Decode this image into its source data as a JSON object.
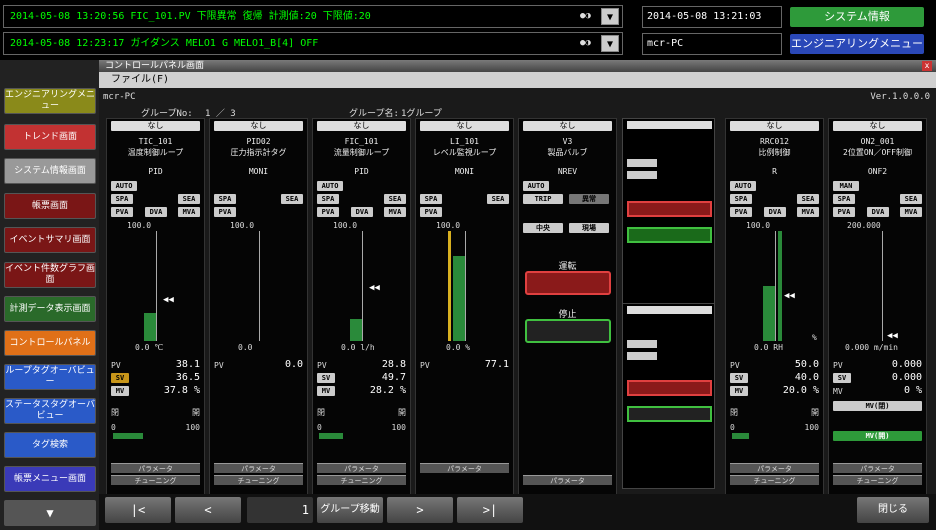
{
  "alarms": [
    {
      "text": "2014-05-08 13:20:56 FIC_101.PV 下限異常 復帰 計測値:20 下限値:20"
    },
    {
      "text": "2014-05-08 12:23:17 ガイダンス MELO1 G MELO1_B[4] OFF"
    }
  ],
  "datetime": "2014-05-08 13:21:03",
  "host": "mcr-PC",
  "sysinfo_label": "システム情報",
  "engmenu_label": "エンジニアリングメニュー",
  "sidebar": [
    "エンジニアリングメニュー",
    "トレンド画面",
    "システム情報画面",
    "帳票画面",
    "イベントサマリ画面",
    "イベント件数グラフ画面",
    "計測データ表示画面",
    "コントロールパネル",
    "ループタグオーバビュー",
    "ステータスタグオーバビュー",
    "タグ検索",
    "帳票メニュー画面"
  ],
  "window": {
    "title": "コントロールパネル画面",
    "menu": "ファイル(F)",
    "host": "mcr-PC",
    "version": "Ver.1.0.0.0",
    "group_no_label": "グループNo:",
    "group_no": "1 ／ 3",
    "group_name_label": "グループ名:",
    "group_name": "1グループ"
  },
  "colors": {
    "green_btn": "#2e9a3a",
    "blue_btn": "#2a48b8",
    "bar": "#2a8a3a"
  },
  "columns": [
    {
      "nashi": "なし",
      "tag": "TIC_101",
      "name": "温度制御ループ",
      "type": "PID",
      "auto": "AUTO",
      "spa": "SPA",
      "sea": "SEA",
      "pva": "PVA",
      "dva": "DVA",
      "mva": "MVA",
      "top": "100.0",
      "bottom": "0.0 ℃",
      "pv_label": "PV",
      "pv": "38.1",
      "sv_label": "SV",
      "sv": "36.5",
      "mv_label": "MV",
      "mv": "37.8 %",
      "close": "閉",
      "open": "開",
      "mv_low": "0",
      "mv_high": "100",
      "param": "パラメータ",
      "tuning": "チューニング",
      "bar_pct": 25,
      "mv_pct": 37.8
    },
    {
      "nashi": "なし",
      "tag": "PID02",
      "name": "圧力指示計タグ",
      "type": "MONI",
      "spa": "SPA",
      "sea": "SEA",
      "pva": "PVA",
      "top": "100.0",
      "bottom": "0.0",
      "pv_label": "PV",
      "pv": "0.0",
      "param": "パラメータ",
      "tuning": "チューニング",
      "bar_pct": 0
    },
    {
      "nashi": "なし",
      "tag": "FIC_101",
      "name": "流量制御ループ",
      "type": "PID",
      "auto": "AUTO",
      "spa": "SPA",
      "sea": "SEA",
      "pva": "PVA",
      "dva": "DVA",
      "mva": "MVA",
      "top": "100.0",
      "bottom": "0.0 l/h",
      "pv_label": "PV",
      "pv": "28.8",
      "sv_label": "SV",
      "sv": "49.7",
      "mv_label": "MV",
      "mv": "28.2 %",
      "close": "閉",
      "open": "開",
      "mv_low": "0",
      "mv_high": "100",
      "param": "パラメータ",
      "tuning": "チューニング",
      "bar_pct": 20,
      "mv_pct": 28.2
    },
    {
      "nashi": "なし",
      "tag": "LI_101",
      "name": "レベル監視ループ",
      "type": "MONI",
      "spa": "SPA",
      "sea": "SEA",
      "pva": "PVA",
      "top": "100.0",
      "bottom": "0.0 %",
      "pv_label": "PV",
      "pv": "77.1",
      "param": "パラメータ",
      "bar_pct": 77
    },
    {
      "nashi": "なし",
      "tag": "V3",
      "name": "製品バルブ",
      "type": "NREV",
      "auto": "AUTO",
      "trip": "TRIP",
      "reset": "異常",
      "central": "中央",
      "local": "現場",
      "run": "運転",
      "stop": "停止",
      "param": "パラメータ"
    },
    {
      "nashi": "なし",
      "tag": "RRC012",
      "name": "比例制御",
      "type": "R",
      "auto": "AUTO",
      "spa": "SPA",
      "sea": "SEA",
      "pva": "PVA",
      "dva": "DVA",
      "mva": "MVA",
      "top": "100.0",
      "bottom": "0.0 RH",
      "pct": "%",
      "pv_label": "PV",
      "pv": "50.0",
      "sv_label": "SV",
      "sv": "40.0",
      "mv_label": "MV",
      "mv": "20.0 %",
      "close": "閉",
      "open": "開",
      "mv_low": "0",
      "mv_high": "100",
      "param": "パラメータ",
      "tuning": "チューニング",
      "bar_pct": 50,
      "mv_pct": 20
    },
    {
      "nashi": "なし",
      "tag": "ON2_001",
      "name": "2位置ON／OFF制御",
      "type": "ONF2",
      "man": "MAN",
      "spa": "SPA",
      "sea": "SEA",
      "pva": "PVA",
      "dva": "DVA",
      "mva": "MVA",
      "top": "200.000",
      "bottom": "0.000 m/min",
      "pv_label": "PV",
      "pv": "0.000",
      "sv_label": "SV",
      "sv": "0.000",
      "mv_label": "MV",
      "mv": "0 %",
      "mv_close": "MV(閉)",
      "mv_open": "MV(開)",
      "param": "パラメータ",
      "tuning": "チューニング",
      "bar_pct": 0
    }
  ],
  "nav": {
    "first": "|<",
    "prev": "<",
    "page": "1",
    "group_move": "グループ移動",
    "next": ">",
    "last": ">|",
    "close": "閉じる"
  }
}
